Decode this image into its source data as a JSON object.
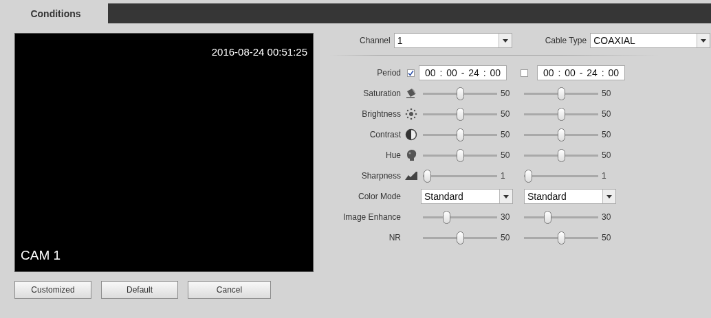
{
  "tab": {
    "label": "Conditions",
    "selected": true
  },
  "preview": {
    "timestamp": "2016-08-24 00:51:25",
    "camera": "CAM 1"
  },
  "channel": {
    "label": "Channel",
    "value": "1"
  },
  "cable_type": {
    "label": "Cable Type",
    "value": "COAXIAL"
  },
  "rows": [
    {
      "kind": "period",
      "label": "Period",
      "left": {
        "checked": true,
        "time": "00 : 00 - 24 : 00"
      },
      "right": {
        "checked": false,
        "time": "00 : 00 - 24 : 00"
      }
    },
    {
      "kind": "slider",
      "label": "Saturation",
      "left": {
        "level": 0.5,
        "value": "50"
      },
      "right": {
        "level": 0.5,
        "value": "50"
      }
    },
    {
      "kind": "slider",
      "label": "Brightness",
      "left": {
        "level": 0.5,
        "value": "50"
      },
      "right": {
        "level": 0.5,
        "value": "50"
      }
    },
    {
      "kind": "slider",
      "label": "Contrast",
      "left": {
        "level": 0.5,
        "value": "50"
      },
      "right": {
        "level": 0.5,
        "value": "50"
      }
    },
    {
      "kind": "slider",
      "label": "Hue",
      "left": {
        "level": 0.5,
        "value": "50"
      },
      "right": {
        "level": 0.5,
        "value": "50"
      }
    },
    {
      "kind": "slider",
      "label": "Sharpness",
      "left": {
        "level": 0.01,
        "value": "1"
      },
      "right": {
        "level": 0.01,
        "value": "1"
      }
    },
    {
      "kind": "select",
      "label": "Color Mode",
      "left": {
        "value": "Standard"
      },
      "right": {
        "value": "Standard"
      }
    },
    {
      "kind": "slider",
      "label": "Image Enhance",
      "left": {
        "level": 0.3,
        "value": "30"
      },
      "right": {
        "level": 0.3,
        "value": "30"
      }
    },
    {
      "kind": "slider",
      "label": "NR",
      "left": {
        "level": 0.5,
        "value": "50"
      },
      "right": {
        "level": 0.5,
        "value": "50"
      }
    }
  ],
  "buttons": [
    "Customized",
    "Default",
    "Cancel"
  ]
}
